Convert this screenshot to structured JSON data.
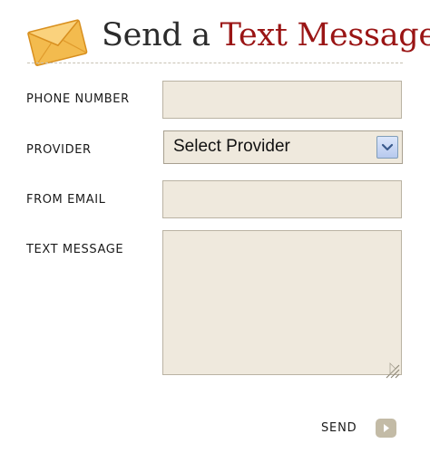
{
  "header": {
    "title_part1": "Send a ",
    "title_part2": "Text Message",
    "icon": "envelope-icon"
  },
  "form": {
    "phone_label": "PHONE NUMBER",
    "phone_value": "",
    "provider_label": "PROVIDER",
    "provider_selected": "Select Provider",
    "from_email_label": "FROM EMAIL",
    "from_email_value": "",
    "message_label": "TEXT MESSAGE",
    "message_value": "",
    "send_label": "SEND",
    "send_icon": "play-arrow-icon"
  },
  "colors": {
    "title_dark": "#2b2b2b",
    "title_accent": "#9a1515",
    "field_bg": "#efe9dd",
    "field_border": "#bab3a3",
    "send_button": "#c3bba6",
    "envelope": "#f2b74a"
  }
}
